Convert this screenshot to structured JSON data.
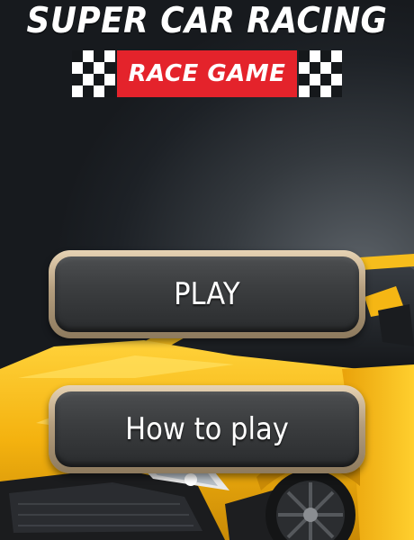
{
  "title": "SUPER CAR RACING",
  "subtitle": "RACE GAME",
  "menu": {
    "play_label": "PLAY",
    "how_to_play_label": "How to play"
  },
  "colors": {
    "badge_red": "#e4232b",
    "car_yellow": "#f4b20f",
    "button_border": "#c8b18d",
    "button_fill": "#3c3e40"
  },
  "icons": [
    "checkered-flag-icon",
    "checkered-flag-icon"
  ]
}
